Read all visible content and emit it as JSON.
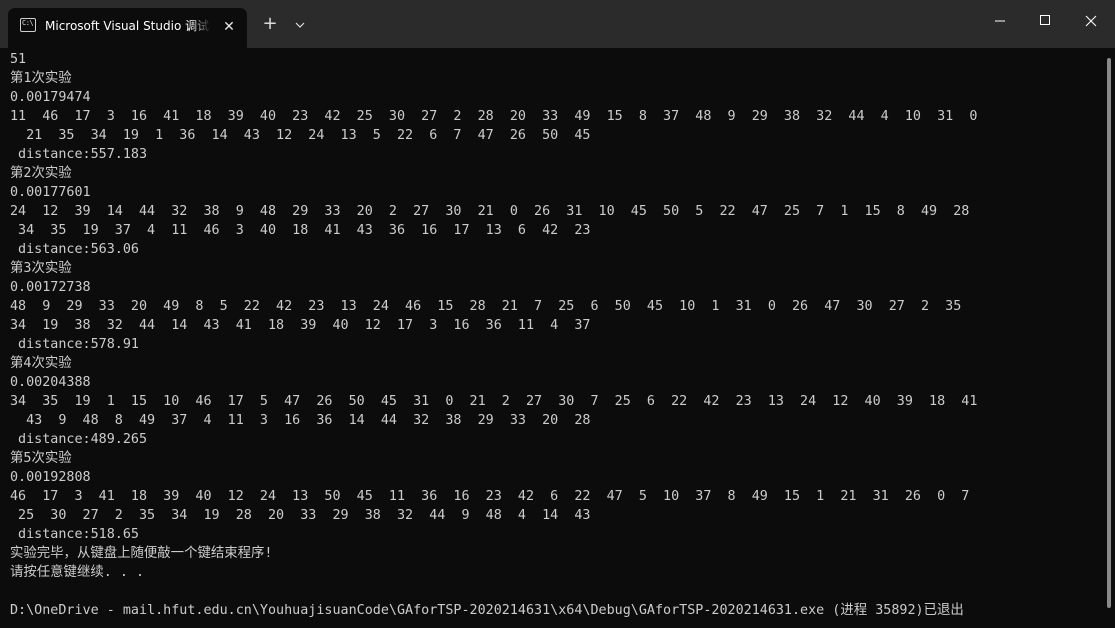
{
  "window": {
    "tab_title": "Microsoft Visual Studio 调试控制台",
    "tab_icon": "console-icon",
    "tab_icon_glyph": "C:\\",
    "close_tab_glyph": "✕",
    "new_tab_glyph": "+",
    "controls": [
      "minimize",
      "maximize",
      "close"
    ]
  },
  "console": {
    "lines": [
      "51",
      "第1次实验",
      "0.00179474",
      "11  46  17  3  16  41  18  39  40  23  42  25  30  27  2  28  20  33  49  15  8  37  48  9  29  38  32  44  4  10  31  0",
      "  21  35  34  19  1  36  14  43  12  24  13  5  22  6  7  47  26  50  45",
      " distance:557.183",
      "第2次实验",
      "0.00177601",
      "24  12  39  14  44  32  38  9  48  29  33  20  2  27  30  21  0  26  31  10  45  50  5  22  47  25  7  1  15  8  49  28",
      " 34  35  19  37  4  11  46  3  40  18  41  43  36  16  17  13  6  42  23",
      " distance:563.06",
      "第3次实验",
      "0.00172738",
      "48  9  29  33  20  49  8  5  22  42  23  13  24  46  15  28  21  7  25  6  50  45  10  1  31  0  26  47  30  27  2  35",
      "34  19  38  32  44  14  43  41  18  39  40  12  17  3  16  36  11  4  37",
      " distance:578.91",
      "第4次实验",
      "0.00204388",
      "34  35  19  1  15  10  46  17  5  47  26  50  45  31  0  21  2  27  30  7  25  6  22  42  23  13  24  12  40  39  18  41",
      "  43  9  48  8  49  37  4  11  3  16  36  14  44  32  38  29  33  20  28",
      " distance:489.265",
      "第5次实验",
      "0.00192808",
      "46  17  3  41  18  39  40  12  24  13  50  45  11  36  16  23  42  6  22  47  5  10  37  8  49  15  1  21  31  26  0  7",
      " 25  30  27  2  35  34  19  28  20  33  29  38  32  44  9  48  4  14  43",
      " distance:518.65",
      "实验完毕，从键盘上随便敲一个键结束程序!",
      "请按任意键继续. . .",
      "",
      "D:\\OneDrive - mail.hfut.edu.cn\\YouhuajisuanCode\\GAforTSP-2020214631\\x64\\Debug\\GAforTSP-2020214631.exe (进程 35892)已退出"
    ]
  },
  "colors": {
    "titlebar": "#2b2b2b",
    "console_bg": "#0c0c0c",
    "console_text": "#cccccc",
    "tab_title": "#ffffff"
  }
}
